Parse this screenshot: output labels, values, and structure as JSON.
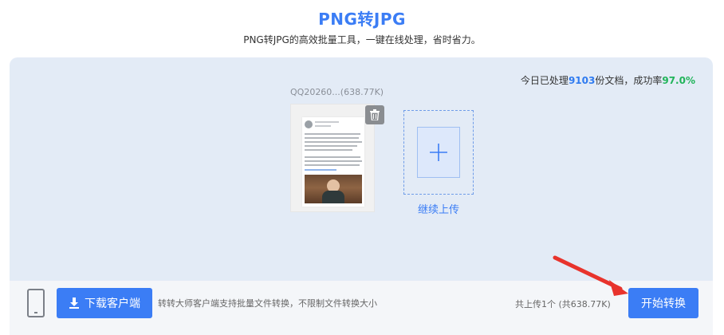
{
  "header": {
    "title": "PNG转JPG",
    "subtitle": "PNG转JPG的高效批量工具，一键在线处理，省时省力。"
  },
  "stats": {
    "prefix": "今日已处理",
    "processed_count": "9103",
    "middle": "份文档，成功率",
    "success_rate": "97.0%"
  },
  "file": {
    "name_label": "QQ20260...(638.77K)"
  },
  "upload": {
    "continue_label": "继续上传"
  },
  "bottom": {
    "download_label": "下载客户端",
    "promo_text": "转转大师客户端支持批量文件转换，不限制文件转换大小",
    "summary_text": "共上传1个 (共638.77K)",
    "start_label": "开始转换"
  },
  "colors": {
    "accent": "#3b7df5",
    "success": "#21b45a",
    "panel_bg": "#e3ebf6",
    "arrow": "#e8332c"
  }
}
